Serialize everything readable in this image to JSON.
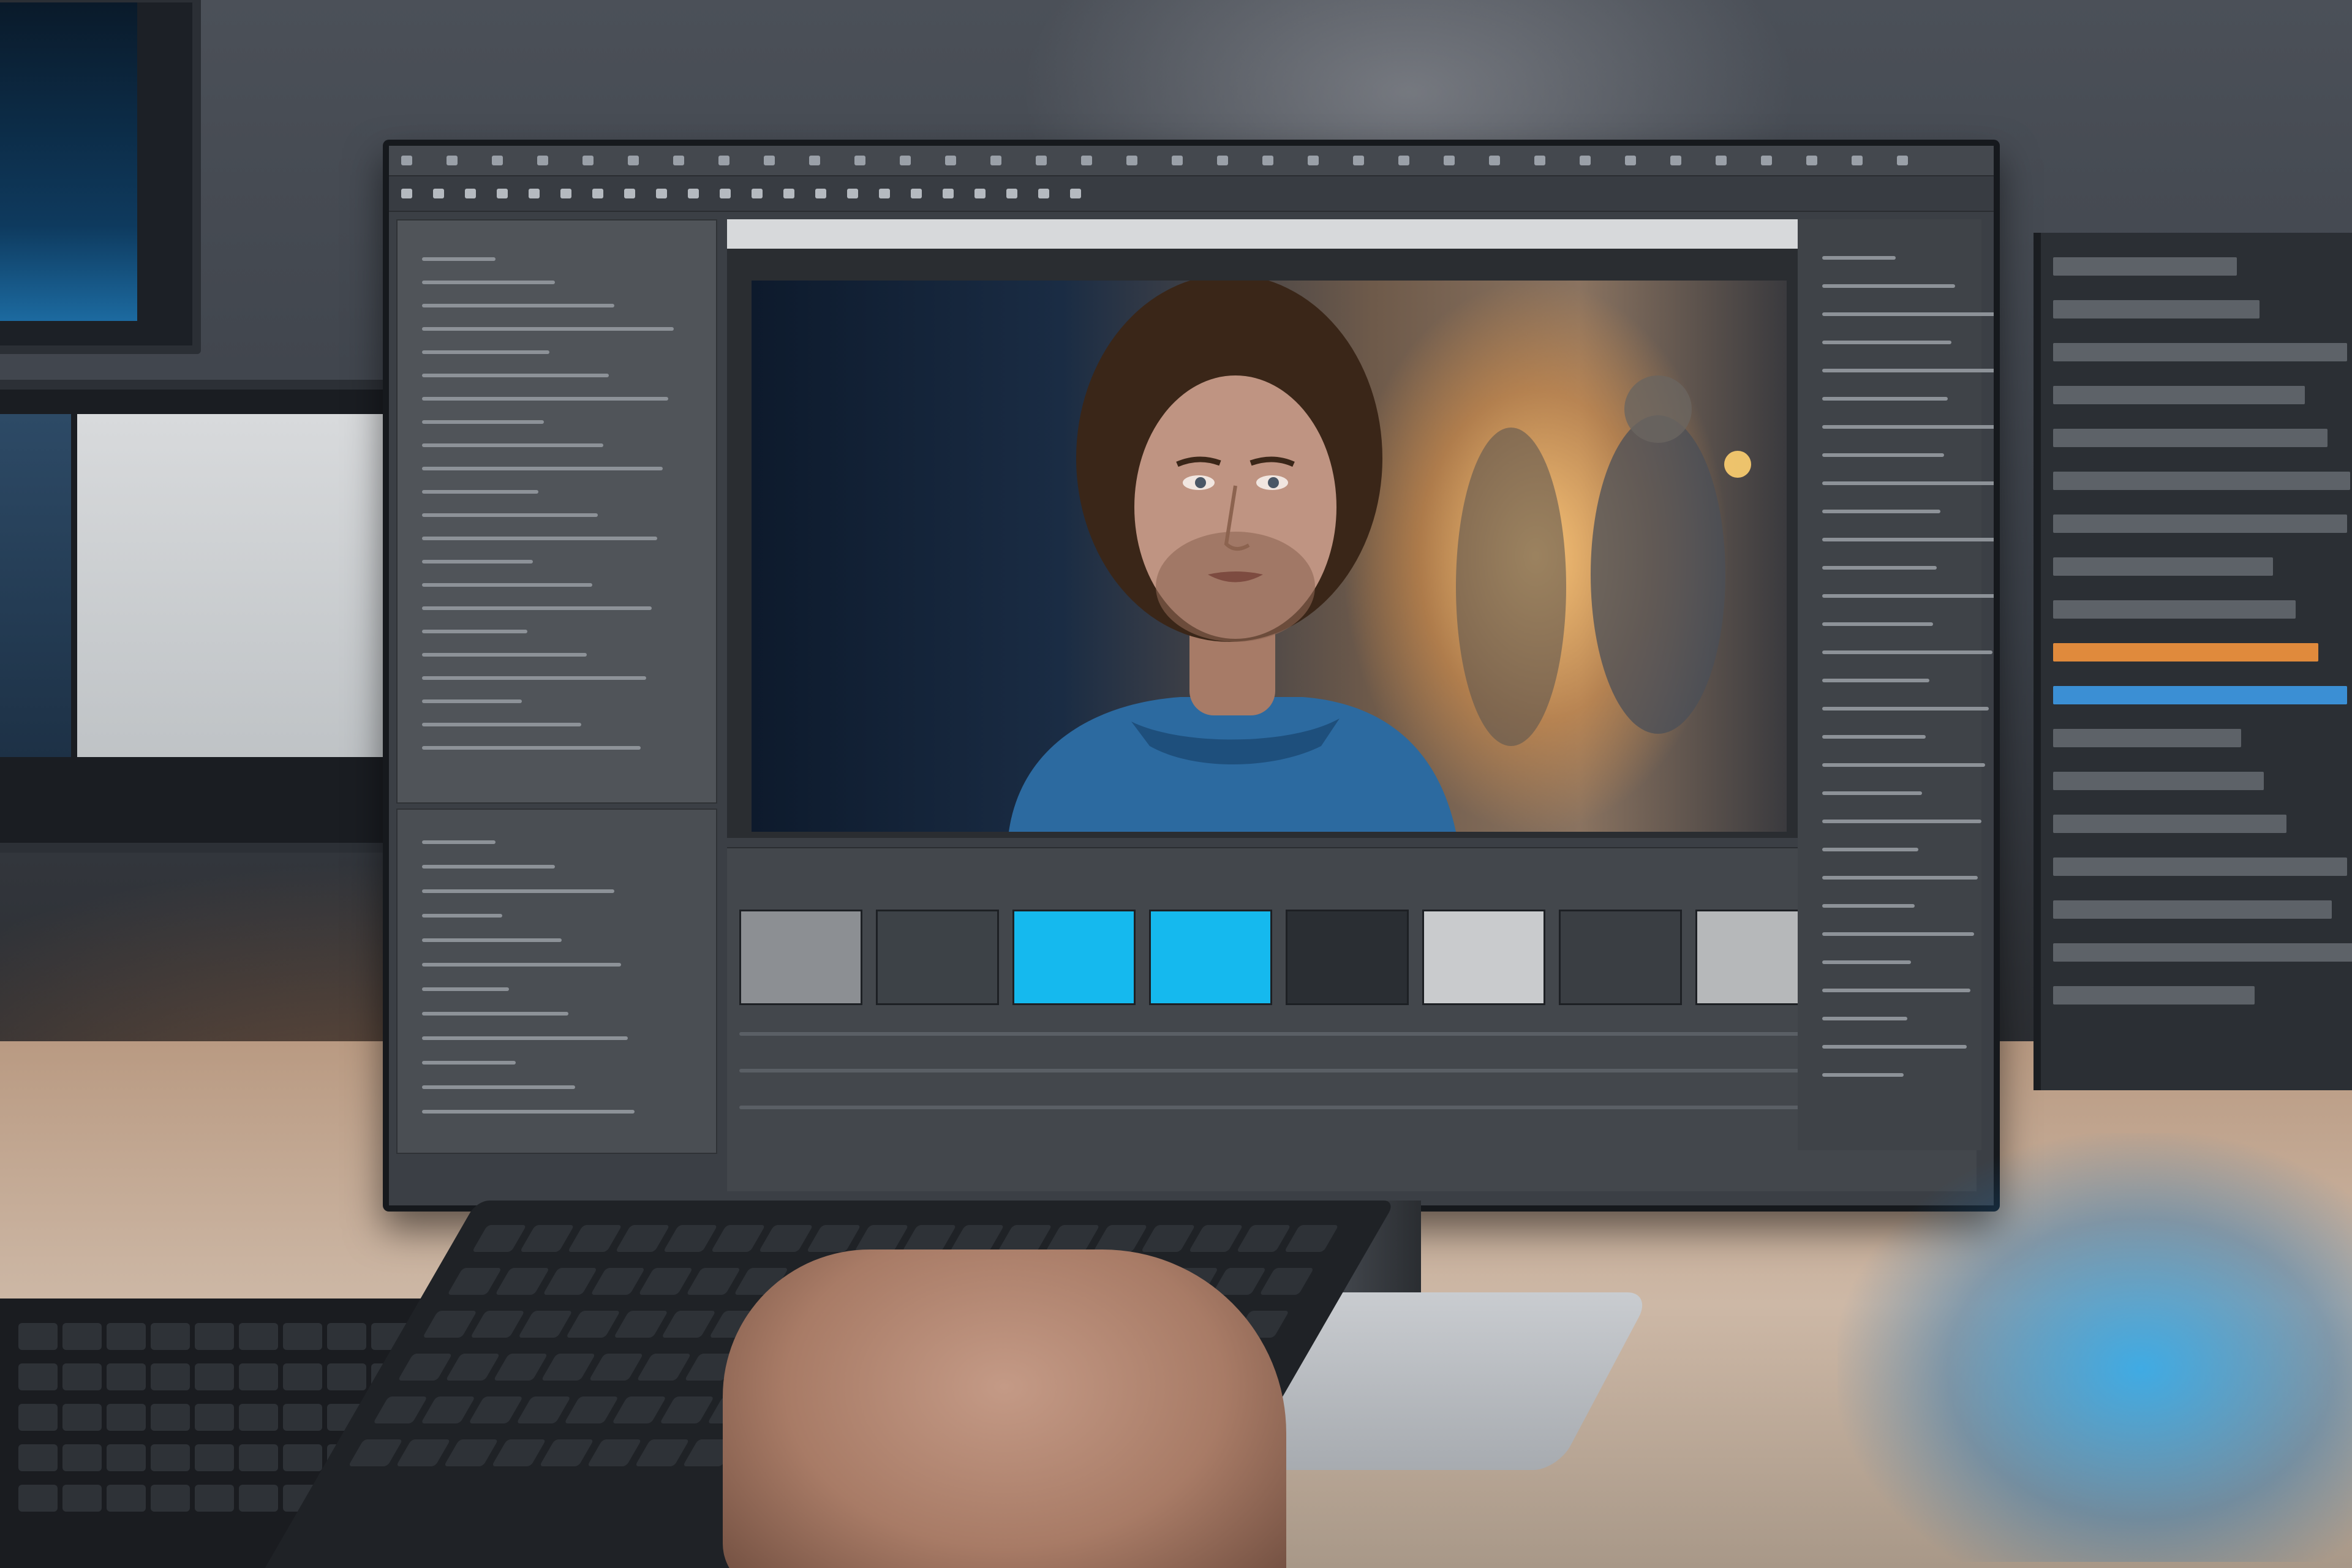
{
  "scene": {
    "description_label": "",
    "background_color": "#3a3f47",
    "desk_color": "#c4ad99",
    "glow_color": "#28aaf0"
  },
  "app_window": {
    "title": "",
    "menubar_icons": 34,
    "toolbar_text": "",
    "viewer": {
      "header_text": "",
      "frame_colors": [
        "#0d1a2c",
        "#ffc878",
        "#1e5a9a"
      ]
    },
    "timeline": {
      "clip_colors": [
        "#8c8f93",
        "#3d4247",
        "#15b9ee",
        "#15b9ee",
        "#2a2e33",
        "#c9cbcd",
        "#3a3e43",
        "#b6b8ba",
        "#30343a"
      ]
    }
  }
}
